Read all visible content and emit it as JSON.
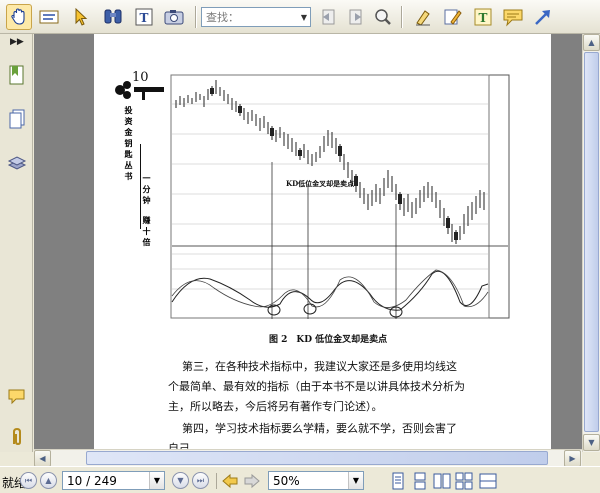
{
  "toolbar": {
    "find_placeholder": "查找："
  },
  "icons": {
    "hand": "hand-tool-icon",
    "select_text": "select-text-icon",
    "pointer": "pointer-icon",
    "binoculars": "find-icon",
    "text": "text-tool-icon",
    "camera": "snapshot-icon",
    "prev_result": "prev-result-icon",
    "next_result": "next-result-icon",
    "search_zoom": "search-zoom-icon",
    "highlight": "highlight-icon",
    "note_edit": "note-edit-icon",
    "text_box": "textbox-icon",
    "comment": "comment-icon",
    "arrow": "arrow-icon"
  },
  "document": {
    "page_number": "10",
    "side_title": "投资金钥匙丛书",
    "side_sub_1": "一分钟",
    "side_sub_2": "赚十倍",
    "chart_annotation": "KD低位金叉却是卖点",
    "figure_caption": "图 2　KD 低位金叉却是卖点",
    "paragraph_1_line_1": "第三，在各种技术指标中，我建议大家还是多使用均线这",
    "paragraph_1_line_2": "个最简单、最有效的指标（由于本书不是以讲具体技术分析为",
    "paragraph_1_line_3": "主，所以略去，今后将另有著作专门论述）。",
    "paragraph_2_line_1": "第四，学习技术指标要么学精，要么就不学，否则会害了",
    "paragraph_2_line_2": "自己。"
  },
  "status": {
    "left_text": "就绪",
    "page_field": "10 / 249",
    "zoom_field": "50%"
  },
  "colors": {
    "active_tool": "#fde9a8",
    "doc_background": "#808080"
  }
}
